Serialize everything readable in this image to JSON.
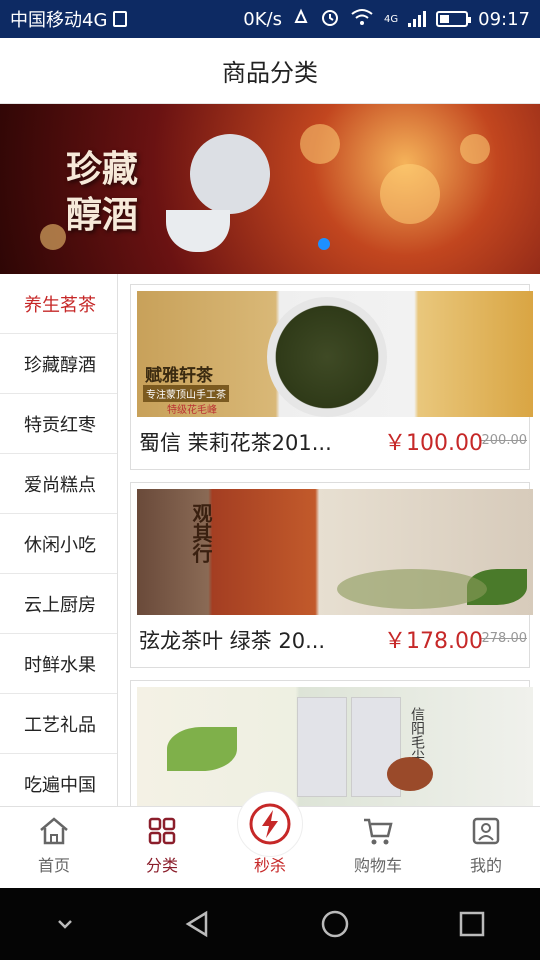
{
  "status_bar": {
    "carrier": "中国移动4G",
    "speed": "0K/s",
    "network": "4G",
    "time": "09:17"
  },
  "header": {
    "title": "商品分类"
  },
  "banner": {
    "text_line1": "珍藏",
    "text_line2": "醇酒",
    "active_dot_color": "#1e90ff"
  },
  "sidebar": {
    "items": [
      {
        "label": "养生茗茶",
        "active": true
      },
      {
        "label": "珍藏醇酒"
      },
      {
        "label": "特贡红枣"
      },
      {
        "label": "爱尚糕点"
      },
      {
        "label": "休闲小吃"
      },
      {
        "label": "云上厨房"
      },
      {
        "label": "时鲜水果"
      },
      {
        "label": "工艺礼品"
      },
      {
        "label": "吃遍中国"
      }
    ]
  },
  "products": [
    {
      "title": "蜀信 茉莉花茶201...",
      "price": "￥100.00",
      "old_price": "200.00",
      "image_text": "赋雅轩茶",
      "image_subtext": "专注蒙顶山手工茶",
      "image_badge": "特级花毛峰"
    },
    {
      "title": "弦龙茶叶 绿茶 20...",
      "price": "￥178.00",
      "old_price": "278.00",
      "image_text": "观其行"
    },
    {
      "title": "",
      "image_text": "信阳毛尖"
    }
  ],
  "bottom_nav": {
    "items": [
      {
        "label": "首页",
        "icon": "home-icon"
      },
      {
        "label": "分类",
        "icon": "category-icon",
        "active": true
      },
      {
        "label": "秒杀",
        "icon": "flash-sale-icon"
      },
      {
        "label": "购物车",
        "icon": "cart-icon"
      },
      {
        "label": "我的",
        "icon": "profile-icon"
      }
    ]
  },
  "colors": {
    "status_bar": "#0d2a63",
    "accent_red": "#c62828",
    "active_nav": "#8b1e2b"
  }
}
